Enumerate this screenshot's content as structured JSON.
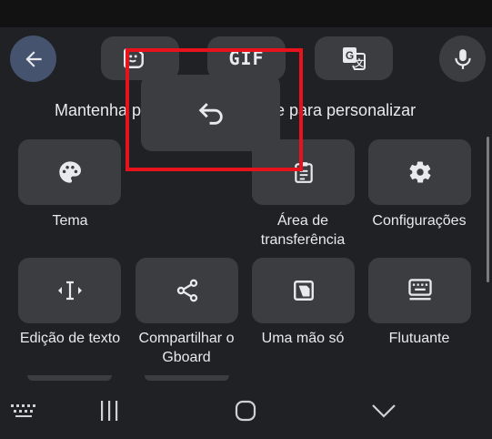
{
  "toolbar": {
    "back_icon": "arrow-back-icon",
    "sticker_icon": "sticker-icon",
    "gif_label": "GIF",
    "translate_icon": "translate-icon",
    "mic_icon": "mic-icon"
  },
  "hint": {
    "left_text": "Mantenha p",
    "right_text": "ste para personalizar"
  },
  "popup": {
    "icon": "undo-icon"
  },
  "tiles": [
    {
      "label": "Tema",
      "icon": "palette-icon"
    },
    {
      "label": "Área de transferência",
      "icon": "clipboard-icon"
    },
    {
      "label": "Configurações",
      "icon": "gear-icon"
    },
    {
      "label": "Edição de texto",
      "icon": "text-cursor-icon"
    },
    {
      "label": "Compartilhar o Gboard",
      "icon": "share-icon"
    },
    {
      "label": "Uma mão só",
      "icon": "one-handed-icon"
    },
    {
      "label": "Flutuante",
      "icon": "floating-keyboard-icon"
    }
  ],
  "navbar": {
    "keyboard_icon": "keyboard-icon",
    "recents_icon": "recents-icon",
    "home_icon": "home-icon",
    "hide_icon": "chevron-down-icon"
  },
  "colors": {
    "background": "#202124",
    "tile": "#3c3d40",
    "back_button": "#45536e",
    "highlight": "#e8121c",
    "text": "#e8eaed"
  }
}
